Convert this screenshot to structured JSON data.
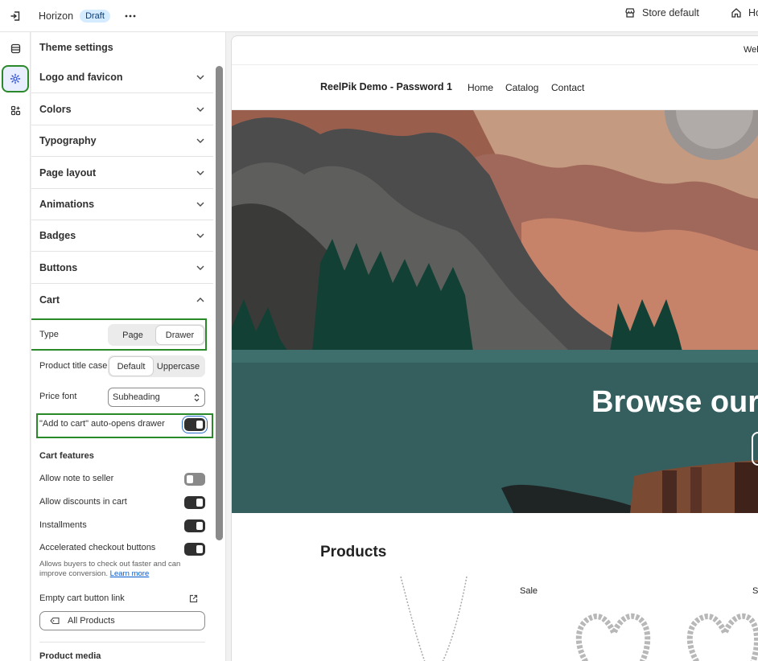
{
  "topbar": {
    "theme_name": "Horizon",
    "badge": "Draft",
    "store_label": "Store default",
    "home_label": "Ho"
  },
  "panel": {
    "title": "Theme settings",
    "sections": [
      {
        "label": "Logo and favicon",
        "state": "collapsed"
      },
      {
        "label": "Colors",
        "state": "collapsed"
      },
      {
        "label": "Typography",
        "state": "collapsed"
      },
      {
        "label": "Page layout",
        "state": "collapsed"
      },
      {
        "label": "Animations",
        "state": "collapsed"
      },
      {
        "label": "Badges",
        "state": "collapsed"
      },
      {
        "label": "Buttons",
        "state": "collapsed"
      },
      {
        "label": "Cart",
        "state": "expanded"
      }
    ],
    "cart": {
      "type_label": "Type",
      "type_options": [
        "Page",
        "Drawer"
      ],
      "type_selected": "Drawer",
      "title_case_label": "Product title case",
      "title_case_options": [
        "Default",
        "Uppercase"
      ],
      "title_case_selected": "Default",
      "price_font_label": "Price font",
      "price_font_value": "Subheading",
      "auto_open_label": "\"Add to cart\" auto-opens drawer",
      "auto_open_on": true,
      "features_heading": "Cart features",
      "features": [
        {
          "label": "Allow note to seller",
          "on": false
        },
        {
          "label": "Allow discounts in cart",
          "on": true
        },
        {
          "label": "Installments",
          "on": true
        },
        {
          "label": "Accelerated checkout buttons",
          "on": true
        }
      ],
      "help_text": "Allows buyers to check out faster and can improve conversion.",
      "help_link": "Learn more",
      "empty_cart_label": "Empty cart button link",
      "empty_cart_value": "All Products"
    },
    "next_section": "Product media"
  },
  "preview": {
    "announcement": "Wel",
    "store_name": "ReelPik Demo - Password 1",
    "nav": [
      "Home",
      "Catalog",
      "Contact"
    ],
    "hero_title": "Browse our",
    "products_title": "Products",
    "badges": [
      "Sale",
      "S"
    ]
  },
  "colors": {
    "highlight": "#2a8a2a",
    "toggle_on": "#303030",
    "toggle_off": "#8a8a8a",
    "link": "#005bd3"
  }
}
